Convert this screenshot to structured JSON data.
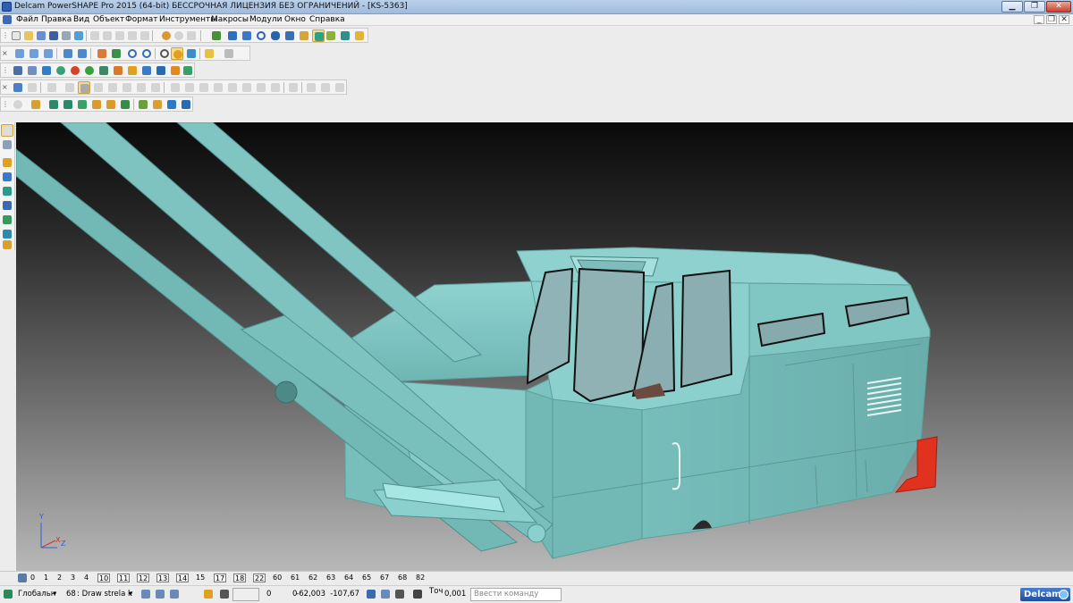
{
  "window": {
    "title": "Delcam PowerSHAPE Pro 2015 (64-bit) БЕССРОЧНАЯ ЛИЦЕНЗИЯ БЕЗ ОГРАНИЧЕНИЙ - [KS-5363]",
    "buttons": {
      "minimize": "▁",
      "maximize": "❐",
      "close": "✕"
    }
  },
  "menu": {
    "items": [
      "Файл",
      "Правка",
      "Вид",
      "Объект",
      "Формат",
      "Инструменты",
      "Макросы",
      "Модули",
      "Окно",
      "Справка"
    ],
    "mdi_buttons": [
      "_",
      "❐",
      "✕"
    ]
  },
  "levels": {
    "icon": "levels-icon",
    "items": [
      "0",
      "1",
      "2",
      "3",
      "4",
      "10",
      "11",
      "12",
      "13",
      "14",
      "15",
      "17",
      "18",
      "22",
      "60",
      "61",
      "62",
      "63",
      "64",
      "65",
      "67",
      "68",
      "82"
    ],
    "boxed": [
      "10",
      "11",
      "12",
      "13",
      "14",
      "17",
      "18",
      "22"
    ]
  },
  "status": {
    "workplane": "Глобальн",
    "level_number": "68",
    "level_name": ": Draw strela k",
    "grid_value": "",
    "x_field": "0",
    "y_field": "0",
    "x_coord": "-62,003",
    "y_coord": "-107,67",
    "tolerance_label": "Точ",
    "tolerance_value": "0,001",
    "command_placeholder": "Ввести команду",
    "brand": "Delcam"
  },
  "viewport": {
    "axis_labels": {
      "y": "Y",
      "x": "X",
      "z": "Z"
    },
    "colors": {
      "model_teal": "#7fc6c3",
      "model_shadow": "#5e9f9c",
      "model_light": "#a6e0de",
      "accent_red": "#e0321e",
      "glass": "#8fb3b6"
    }
  }
}
